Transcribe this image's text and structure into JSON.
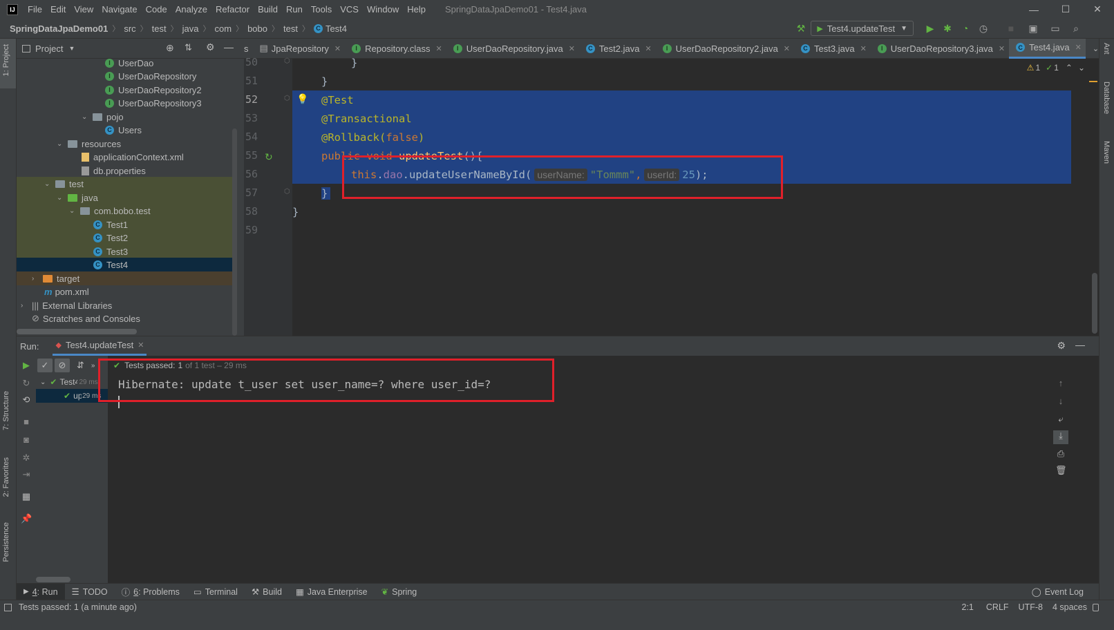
{
  "window": {
    "title": "SpringDataJpaDemo01 - Test4.java",
    "app_icon": "IJ"
  },
  "menu": [
    "File",
    "Edit",
    "View",
    "Navigate",
    "Code",
    "Analyze",
    "Refactor",
    "Build",
    "Run",
    "Tools",
    "VCS",
    "Window",
    "Help"
  ],
  "breadcrumb": [
    "SpringDataJpaDemo01",
    "src",
    "test",
    "java",
    "com",
    "bobo",
    "test",
    "Test4"
  ],
  "run_config": "Test4.updateTest",
  "project_panel": {
    "title": "Project",
    "tree": [
      {
        "label": "UserDao",
        "icon": "interface-icon"
      },
      {
        "label": "UserDaoRepository",
        "icon": "interface-icon"
      },
      {
        "label": "UserDaoRepository2",
        "icon": "interface-icon"
      },
      {
        "label": "UserDaoRepository3",
        "icon": "interface-icon"
      },
      {
        "label": "pojo",
        "icon": "folder-icon"
      },
      {
        "label": "Users",
        "icon": "class-icon"
      },
      {
        "label": "resources",
        "icon": "folder-icon"
      },
      {
        "label": "applicationContext.xml",
        "icon": "xml-file-icon"
      },
      {
        "label": "db.properties",
        "icon": "properties-file-icon"
      },
      {
        "label": "test",
        "icon": "folder-icon"
      },
      {
        "label": "java",
        "icon": "test-folder-icon"
      },
      {
        "label": "com.bobo.test",
        "icon": "package-icon"
      },
      {
        "label": "Test1",
        "icon": "class-icon"
      },
      {
        "label": "Test2",
        "icon": "class-icon"
      },
      {
        "label": "Test3",
        "icon": "class-icon"
      },
      {
        "label": "Test4",
        "icon": "class-icon"
      },
      {
        "label": "target",
        "icon": "excluded-folder-icon"
      },
      {
        "label": "pom.xml",
        "icon": "maven-icon"
      },
      {
        "label": "External Libraries",
        "icon": "library-icon"
      },
      {
        "label": "Scratches and Consoles",
        "icon": "scratches-icon"
      }
    ]
  },
  "editor_tabs": [
    {
      "label": "s",
      "partial": true
    },
    {
      "label": "JpaRepository"
    },
    {
      "label": "Repository.class"
    },
    {
      "label": "UserDaoRepository.java"
    },
    {
      "label": "Test2.java"
    },
    {
      "label": "UserDaoRepository2.java"
    },
    {
      "label": "Test3.java"
    },
    {
      "label": "UserDaoRepository3.java"
    },
    {
      "label": "Test4.java",
      "active": true
    }
  ],
  "editor": {
    "inspections": {
      "warnings": "1",
      "ok": "1"
    },
    "line_numbers": [
      "50",
      "51",
      "52",
      "53",
      "54",
      "55",
      "56",
      "57",
      "58",
      "59"
    ],
    "code": {
      "l50": "}",
      "l51": "}",
      "l52": "@Test",
      "l53": "@Transactional",
      "l54a": "@Rollback(",
      "l54b": "false",
      "l54c": ")",
      "l55a": "public void ",
      "l55b": "updateTest",
      "l55c": "(){",
      "l56a": "this",
      "l56b": ".",
      "l56c": "dao",
      "l56d": ".updateUserNameById(",
      "hint_username": "userName:",
      "l56e": "\"Tommm\"",
      "l56f": ",",
      "hint_userid": "userId:",
      "l56g": "25",
      "l56h": ");",
      "l57": "}",
      "l58": "}"
    }
  },
  "run_panel": {
    "label": "Run:",
    "tab": "Test4.updateTest",
    "status": "Tests passed:",
    "status_count": "1",
    "status_rest": "of 1 test – 29 ms",
    "tree": [
      {
        "label": "Test4",
        "time": "29 ms"
      },
      {
        "label": "up",
        "time": "29 ms"
      }
    ],
    "console": [
      "Hibernate: update t_user set user_name=? where user_id=?"
    ]
  },
  "left_stripe": [
    "1: Project",
    "7: Structure",
    "2: Favorites",
    "Persistence"
  ],
  "right_stripe": [
    "Ant",
    "Database",
    "Maven"
  ],
  "bottom_tabs": [
    {
      "num": "4",
      "label": ": Run",
      "active": true
    },
    {
      "label": "TODO"
    },
    {
      "num": "6",
      "label": ": Problems"
    },
    {
      "label": "Terminal"
    },
    {
      "label": "Build"
    },
    {
      "label": "Java Enterprise"
    },
    {
      "label": "Spring"
    }
  ],
  "event_log": "Event Log",
  "statusbar": {
    "message": "Tests passed: 1 (a minute ago)",
    "position": "2:1",
    "line_sep": "CRLF",
    "encoding": "UTF-8",
    "indent": "4 spaces"
  },
  "colors": {
    "selection": "#214283",
    "highlight_box": "#e0202a",
    "accent": "#4a88c7"
  }
}
